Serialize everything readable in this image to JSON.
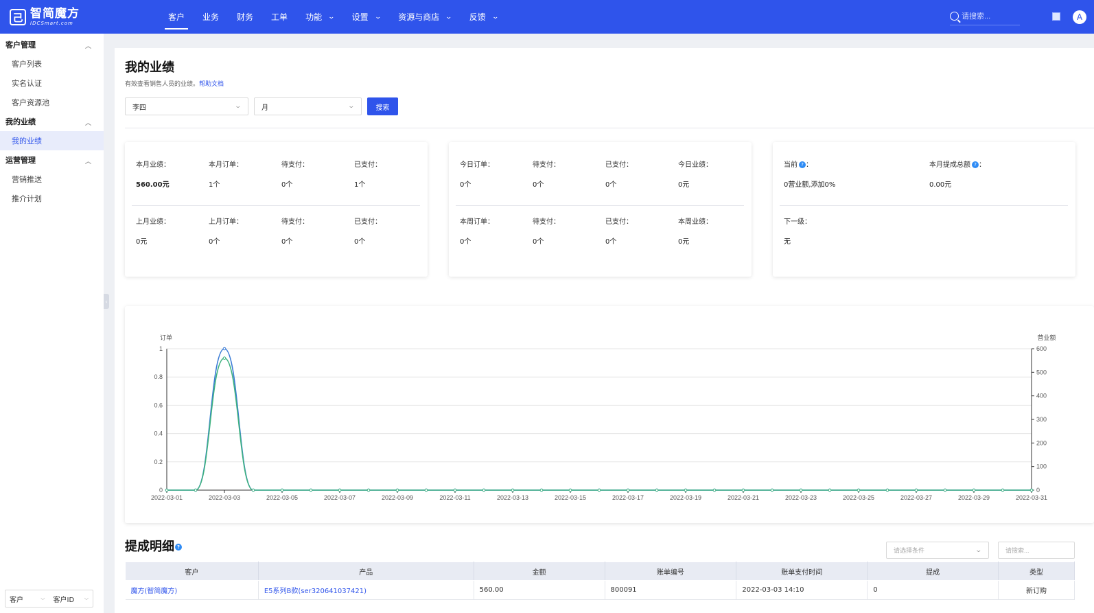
{
  "topbar": {
    "logo_cn": "智简魔方",
    "logo_en": "IDCSmart.com",
    "nav": [
      {
        "label": "客户",
        "dropdown": false,
        "active": true
      },
      {
        "label": "业务",
        "dropdown": false
      },
      {
        "label": "财务",
        "dropdown": false
      },
      {
        "label": "工单",
        "dropdown": false
      },
      {
        "label": "功能",
        "dropdown": true
      },
      {
        "label": "设置",
        "dropdown": true
      },
      {
        "label": "资源与商店",
        "dropdown": true
      },
      {
        "label": "反馈",
        "dropdown": true
      }
    ],
    "search_placeholder": "请搜索...",
    "avatar_letter": "A",
    "colors": {
      "bar": "#2f54eb"
    }
  },
  "sidebar": {
    "groups": [
      {
        "label": "客户管理",
        "items": [
          {
            "label": "客户列表"
          },
          {
            "label": "实名认证"
          },
          {
            "label": "客户资源池"
          }
        ]
      },
      {
        "label": "我的业绩",
        "items": [
          {
            "label": "我的业绩",
            "active": true
          }
        ]
      },
      {
        "label": "运营管理",
        "items": [
          {
            "label": "营销推送"
          },
          {
            "label": "推介计划"
          }
        ]
      }
    ],
    "footer": {
      "select1": "客户",
      "select2": "客户ID"
    }
  },
  "page": {
    "title": "我的业绩",
    "subtitle": "有效查看销售人员的业绩。",
    "help_link": "帮助文档",
    "filter_person": "李四",
    "filter_period": "月",
    "search_button": "搜索"
  },
  "stats": {
    "card1": {
      "top": [
        {
          "label": "本月业绩：",
          "value": "560.00元",
          "bold": true
        },
        {
          "label": "本月订单：",
          "value": "1个"
        },
        {
          "label": "待支付：",
          "value": "0个"
        },
        {
          "label": "已支付：",
          "value": "1个"
        }
      ],
      "bottom": [
        {
          "label": "上月业绩：",
          "value": "0元"
        },
        {
          "label": "上月订单：",
          "value": "0个"
        },
        {
          "label": "待支付：",
          "value": "0个"
        },
        {
          "label": "已支付：",
          "value": "0个"
        }
      ]
    },
    "card2": {
      "top": [
        {
          "label": "今日订单：",
          "value": "0个"
        },
        {
          "label": "待支付：",
          "value": "0个"
        },
        {
          "label": "已支付：",
          "value": "0个"
        },
        {
          "label": "今日业绩：",
          "value": "0元"
        }
      ],
      "bottom": [
        {
          "label": "本周订单：",
          "value": "0个"
        },
        {
          "label": "待支付：",
          "value": "0个"
        },
        {
          "label": "已支付：",
          "value": "0个"
        },
        {
          "label": "本周业绩：",
          "value": "0元"
        }
      ]
    },
    "card3": {
      "top": [
        {
          "label": "当前",
          "suffix": "：",
          "value": "0营业额,添加0%",
          "help": true
        },
        {
          "label": "本月提成总额",
          "suffix": "：",
          "value": "0.00元",
          "help": true
        }
      ],
      "bottom": [
        {
          "label": "下一级：",
          "value": "无"
        }
      ]
    }
  },
  "chart_data": {
    "type": "line",
    "ylabel": "订单",
    "y2label": "营业额",
    "ylim": [
      0,
      1
    ],
    "y2lim": [
      0,
      600
    ],
    "yticks": [
      "0",
      "0.2",
      "0.4",
      "0.6",
      "0.8",
      "1"
    ],
    "y2ticks": [
      "0",
      "100",
      "200",
      "300",
      "400",
      "500",
      "600"
    ],
    "x": [
      "2022-03-01",
      "2022-03-02",
      "2022-03-03",
      "2022-03-04",
      "2022-03-05",
      "2022-03-06",
      "2022-03-07",
      "2022-03-08",
      "2022-03-09",
      "2022-03-10",
      "2022-03-11",
      "2022-03-12",
      "2022-03-13",
      "2022-03-14",
      "2022-03-15",
      "2022-03-16",
      "2022-03-17",
      "2022-03-18",
      "2022-03-19",
      "2022-03-20",
      "2022-03-21",
      "2022-03-22",
      "2022-03-23",
      "2022-03-24",
      "2022-03-25",
      "2022-03-26",
      "2022-03-27",
      "2022-03-28",
      "2022-03-29",
      "2022-03-30",
      "2022-03-31"
    ],
    "xticks": [
      "2022-03-01",
      "2022-03-03",
      "2022-03-05",
      "2022-03-07",
      "2022-03-09",
      "2022-03-11",
      "2022-03-13",
      "2022-03-15",
      "2022-03-17",
      "2022-03-19",
      "2022-03-21",
      "2022-03-23",
      "2022-03-25",
      "2022-03-27",
      "2022-03-29",
      "2022-03-31"
    ],
    "series": [
      {
        "axis": "left",
        "color": "#3a7bd5",
        "values": [
          0,
          0,
          1,
          0,
          0,
          0,
          0,
          0,
          0,
          0,
          0,
          0,
          0,
          0,
          0,
          0,
          0,
          0,
          0,
          0,
          0,
          0,
          0,
          0,
          0,
          0,
          0,
          0,
          0,
          0,
          0
        ]
      },
      {
        "axis": "right",
        "color": "#3fb27f",
        "values": [
          0,
          0,
          560,
          0,
          0,
          0,
          0,
          0,
          0,
          0,
          0,
          0,
          0,
          0,
          0,
          0,
          0,
          0,
          0,
          0,
          0,
          0,
          0,
          0,
          0,
          0,
          0,
          0,
          0,
          0,
          0
        ]
      }
    ],
    "grid": true
  },
  "detail": {
    "title": "提成明细",
    "filter_placeholder": "请选择条件",
    "search_placeholder": "请搜索...",
    "columns": [
      "客户",
      "产品",
      "金额",
      "账单编号",
      "账单支付时间",
      "提成",
      "类型"
    ],
    "rows": [
      {
        "customer": "魔方(智简魔方)",
        "product": "E5系列B款(ser320641037421)",
        "amount": "560.00",
        "invoice": "800091",
        "paid_at": "2022-03-03 14:10",
        "commission": "0",
        "type": "新订购"
      }
    ]
  }
}
